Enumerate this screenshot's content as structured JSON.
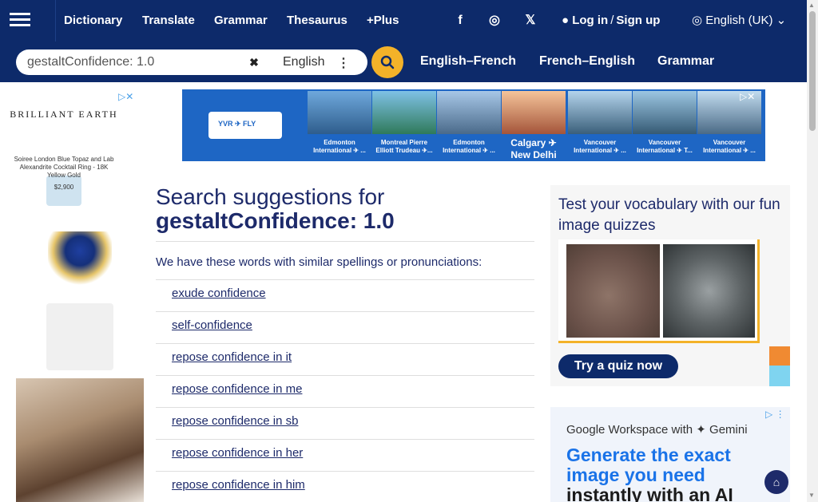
{
  "nav": {
    "links": [
      "Dictionary",
      "Translate",
      "Grammar",
      "Thesaurus",
      "+Plus"
    ],
    "social": [
      {
        "icon": "facebook-icon",
        "glyph": "f"
      },
      {
        "icon": "instagram-icon",
        "glyph": "◎"
      },
      {
        "icon": "x-icon",
        "glyph": "𝕏"
      }
    ],
    "login": "Log in",
    "separator": "/",
    "signup": "Sign up",
    "language": "English (UK)"
  },
  "search": {
    "value": "gestaltConfidence: 1.0",
    "clear_glyph": "✖",
    "dictionary": "English",
    "dots": "⋮"
  },
  "quick_links": [
    "English–French",
    "French–English",
    "Grammar"
  ],
  "left_ad": {
    "brand": "BRILLIANT EARTH",
    "title": "Soiree London Blue Topaz and Lab Alexandrite Cocktail Ring - 18K Yellow Gold",
    "price": "$2,900"
  },
  "top_ad": {
    "logo_text": "YVR ✈ FLY",
    "tiles": [
      "Edmonton International ✈ ...",
      "Montreal Pierre Elliott Trudeau ✈...",
      "Edmonton International ✈ ...",
      "Calgary ✈ New Delhi",
      "Vancouver International ✈ ...",
      "Vancouver International ✈ T...",
      "Vancouver International ✈ ..."
    ]
  },
  "main": {
    "title_prefix": "Search suggestions for",
    "query": "gestaltConfidence: 1.0",
    "intro": "We have these words with similar spellings or pronunciations:",
    "suggestions": [
      "exude confidence",
      "self-confidence",
      "repose confidence in it",
      "repose confidence in me",
      "repose confidence in sb",
      "repose confidence in her",
      "repose confidence in him"
    ]
  },
  "quiz": {
    "title": "Test your vocabulary with our fun image quizzes",
    "button": "Try a quiz now"
  },
  "gw_ad": {
    "title": "Google Workspace with ✦ Gemini",
    "headline_blue": "Generate the exact image you need",
    "headline_dark": "instantly with an AI prompt in"
  },
  "scroll_top_glyph": "⌂",
  "colors": {
    "nav_bg": "#0d2a6a",
    "accent": "#f3b229",
    "link": "#1d2a6a"
  }
}
